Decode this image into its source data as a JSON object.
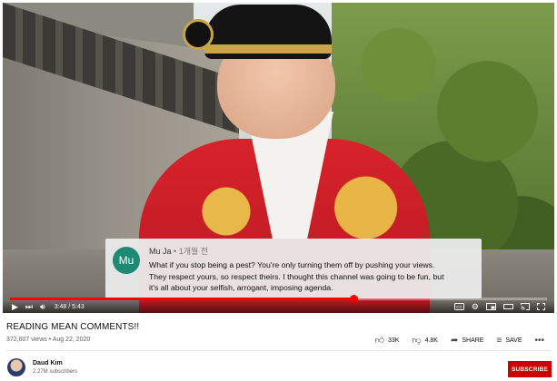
{
  "comment": {
    "avatar_initials": "Mu",
    "author": "Mu Ja",
    "separator": "•",
    "time_ago": "1개월 전",
    "lines": [
      "What if you stop being a pest?  You're only turning them off by pushing your views.",
      "They respect yours, so respect theirs. I thought this channel was going to be fun, but",
      "it's all about your selfish, arrogant, imposing agenda."
    ],
    "avatar_color": "#1f8a73"
  },
  "player": {
    "progress": 0.64,
    "current_time": "3:48",
    "duration": "5:43",
    "time_display": "3:48 / 5:43",
    "progress_color": "#ff0000",
    "controls": {
      "play": "play-icon",
      "next": "next-icon",
      "volume": "volume-icon",
      "subtitles": "cc-icon",
      "settings": "gear-icon",
      "miniplayer": "miniplayer-icon",
      "theater": "theater-icon",
      "cast": "cast-icon",
      "fullscreen": "fullscreen-icon"
    }
  },
  "video": {
    "title": "READING MEAN COMMENTS!!",
    "views": "372,607 views",
    "date": "Aug 22, 2020",
    "meta": "372,607 views • Aug 22, 2020"
  },
  "actions": {
    "likes": "33K",
    "dislikes": "4.8K",
    "share_label": "SHARE",
    "save_label": "SAVE",
    "more": "•••"
  },
  "channel": {
    "name": "Daud Kim",
    "subscribers": "2.27M subscribers",
    "subscribe_label": "SUBSCRIBE",
    "subscribe_color": "#cc0000"
  }
}
